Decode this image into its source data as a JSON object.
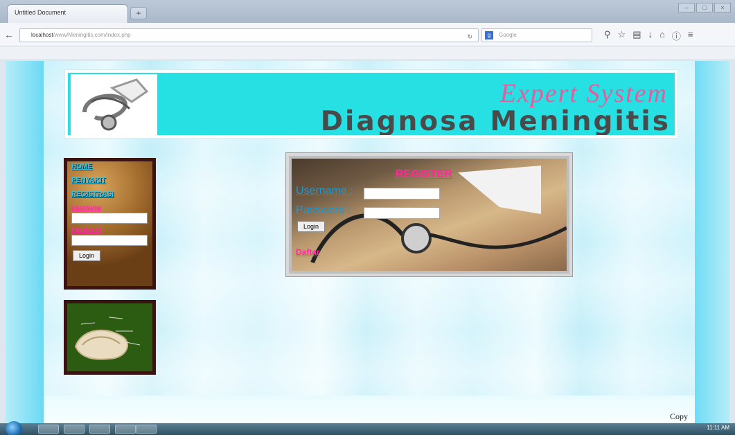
{
  "browser": {
    "tab_title": "Untitled Document",
    "new_tab": "+",
    "url_host": "localhost",
    "url_path": "/www/Meningitis.com/index.php",
    "search_placeholder": "Google",
    "search_engine_icon": "g-icon",
    "toolbar_icons": [
      "search-icon",
      "star-icon",
      "bookmark-list-icon",
      "download-icon",
      "home-icon",
      "info-icon",
      "menu-icon"
    ]
  },
  "header": {
    "subtitle": "Expert System",
    "title": "Diagnosa Meningitis"
  },
  "sidebar": {
    "menu": [
      "HOME",
      "PENYAKIT",
      "REGISTRASI"
    ],
    "username_label": "Username",
    "password_label": "Password",
    "login_button": "Login"
  },
  "register": {
    "title": "REGISTER",
    "username_label": "Username :",
    "password_label": "Password :",
    "login_button": "Login",
    "daftar_link": "Daftar"
  },
  "footer": {
    "copyright": "Copy"
  },
  "taskbar": {
    "clock": "11:11 AM"
  }
}
